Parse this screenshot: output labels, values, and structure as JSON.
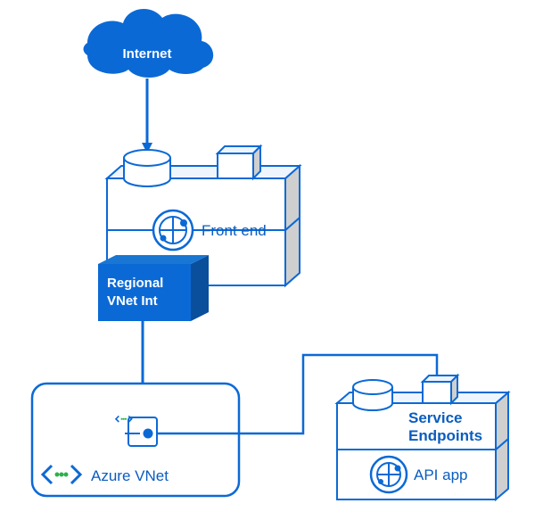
{
  "diagram": {
    "internet_label": "Internet",
    "frontend_label": "Front end",
    "vnet_int_label_line1": "Regional",
    "vnet_int_label_line2": "VNet Int",
    "azure_vnet_label": "Azure VNet",
    "service_endpoints_label_line1": "Service",
    "service_endpoints_label_line2": "Endpoints",
    "api_app_label": "API app",
    "colors": {
      "azure_blue": "#0b69d6",
      "azure_blue_dark": "#0a4f9c",
      "fill_light": "#ffffff",
      "shadow": "#e6e6e6"
    }
  }
}
